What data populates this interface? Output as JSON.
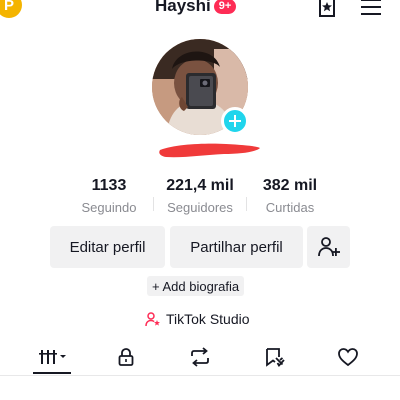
{
  "header": {
    "coin_letter": "P",
    "username": "Hayshi",
    "notification_badge": "9+",
    "icons": [
      "coin-icon",
      "bookmark-star-icon",
      "menu-icon"
    ]
  },
  "profile": {
    "add_avatar_icon": "plus-icon"
  },
  "stats": [
    {
      "value": "1133",
      "label": "Seguindo"
    },
    {
      "value": "221,4 mil",
      "label": "Seguidores"
    },
    {
      "value": "382 mil",
      "label": "Curtidas"
    }
  ],
  "actions": {
    "edit_profile": "Editar perfil",
    "share_profile": "Partilhar perfil",
    "add_friend_icon": "add-user-icon"
  },
  "bio": {
    "label": "+ Add biografia"
  },
  "studio": {
    "label": "TikTok Studio",
    "icon": "studio-person-icon"
  },
  "tabs": [
    {
      "icon": "grid-sort-icon",
      "selected": true
    },
    {
      "icon": "lock-icon",
      "selected": false
    },
    {
      "icon": "repost-icon",
      "selected": false
    },
    {
      "icon": "favorites-icon",
      "selected": false
    },
    {
      "icon": "heart-icon",
      "selected": false
    }
  ],
  "colors": {
    "accent_pink": "#fe2c55",
    "avatar_add": "#20d5ec",
    "coin": "#f4b400",
    "button_bg": "#f1f1f2",
    "muted_text": "#8a8b91",
    "redaction": "#f03a3a"
  }
}
